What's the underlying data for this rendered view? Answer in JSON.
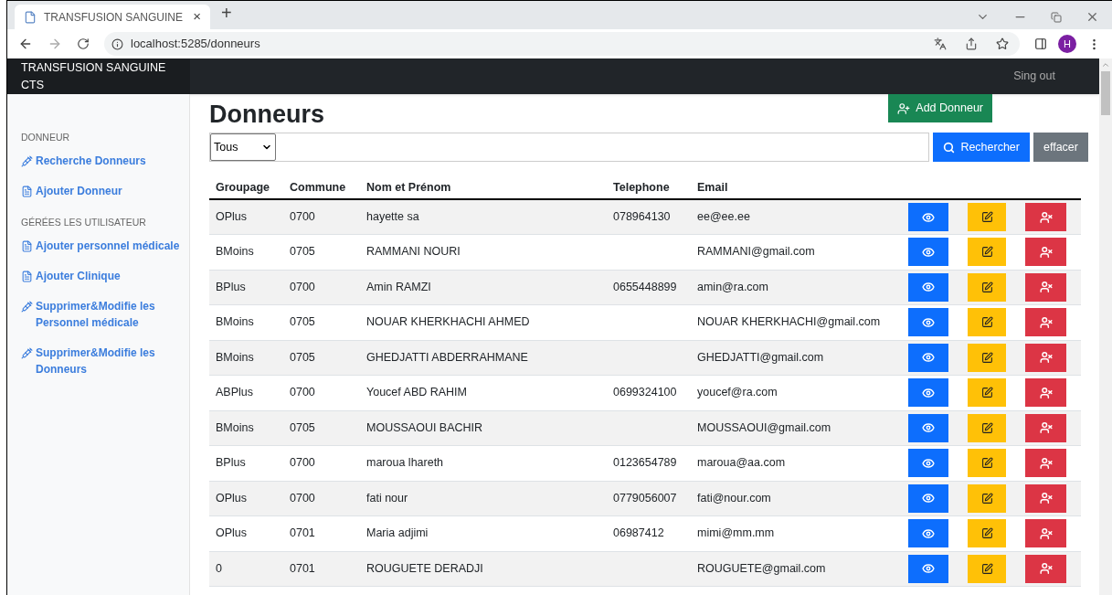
{
  "browser": {
    "tab_title": "TRANSFUSION SANGUINE",
    "tab_close": "×",
    "new_tab": "+",
    "address": "localhost:5285/donneurs",
    "profile_initial": "H"
  },
  "navbar": {
    "brand": "TRANSFUSION SANGUINE CTS",
    "signout": "Sing out"
  },
  "sidebar": {
    "sections": [
      {
        "heading": "DONNEUR",
        "items": [
          {
            "kind": "syringe",
            "label": "Recherche Donneurs"
          },
          {
            "kind": "file",
            "label": "Ajouter Donneur"
          }
        ]
      },
      {
        "heading": "GÉRÉES LES UTILISATEUR",
        "items": [
          {
            "kind": "file",
            "label": "Ajouter personnel médicale"
          },
          {
            "kind": "file",
            "label": "Ajouter Clinique"
          },
          {
            "kind": "syringe",
            "label": "Supprimer&Modifie les Personnel médicale"
          },
          {
            "kind": "syringe",
            "label": "Supprimer&Modifie les Donneurs"
          }
        ]
      }
    ]
  },
  "page": {
    "title": "Donneurs",
    "add_button": "Add Donneur"
  },
  "search": {
    "filter": "Tous",
    "search_button": "Rechercher",
    "clear_button": "effacer"
  },
  "table": {
    "columns": [
      "Groupage",
      "Commune",
      "Nom et Prénom",
      "Telephone",
      "Email"
    ],
    "rows": [
      {
        "cells": [
          "OPlus",
          "0700",
          "hayette sa",
          "078964130",
          "ee@ee.ee"
        ]
      },
      {
        "cells": [
          "BMoins",
          "0705",
          "RAMMANI NOURI",
          "",
          "RAMMANI@gmail.com"
        ]
      },
      {
        "cells": [
          "BPlus",
          "0700",
          "Amin RAMZI",
          "0655448899",
          "amin@ra.com"
        ]
      },
      {
        "cells": [
          "BMoins",
          "0705",
          "NOUAR KHERKHACHI AHMED",
          "",
          "NOUAR KHERKHACHI@gmail.com"
        ]
      },
      {
        "cells": [
          "BMoins",
          "0705",
          "GHEDJATTI ABDERRAHMANE",
          "",
          "GHEDJATTI@gmail.com"
        ]
      },
      {
        "cells": [
          "ABPlus",
          "0700",
          "Youcef ABD RAHIM",
          "0699324100",
          "youcef@ra.com"
        ]
      },
      {
        "cells": [
          "BMoins",
          "0705",
          "MOUSSAOUI BACHIR",
          "",
          "MOUSSAOUI@gmail.com"
        ]
      },
      {
        "cells": [
          "BPlus",
          "0700",
          "maroua lhareth",
          "0123654789",
          "maroua@aa.com"
        ]
      },
      {
        "cells": [
          "OPlus",
          "0700",
          "fati nour",
          "0779056007",
          "fati@nour.com"
        ]
      },
      {
        "cells": [
          "OPlus",
          "0701",
          "Maria adjimi",
          "06987412",
          "mimi@mm.mm"
        ]
      },
      {
        "cells": [
          "0",
          "0701",
          "ROUGUETE DERADJI",
          "",
          "ROUGUETE@gmail.com"
        ]
      }
    ]
  }
}
